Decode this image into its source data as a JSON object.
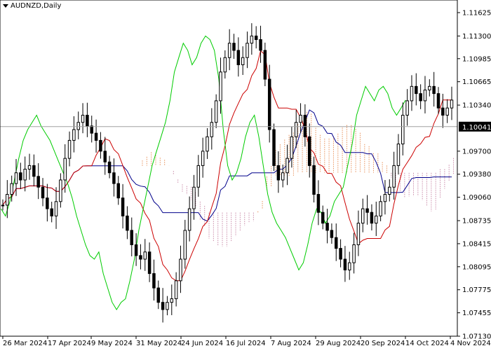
{
  "symbol": {
    "label": "AUDNZD,Daily"
  },
  "colors": {
    "candle": "#000000",
    "tenkan": "#cc0000",
    "kijun": "#00008b",
    "chikou": "#00cc00",
    "cloud_bull": "#e8915a",
    "cloud_bear": "#c98aa8",
    "current_line": "#a0a0a0",
    "price_badge_bg": "#000000",
    "price_badge_fg": "#ffffff"
  },
  "chart_data": {
    "type": "candlestick",
    "title": "AUDNZD,Daily",
    "indicator": "Ichimoku Kinko Hyo",
    "ylim": [
      1.0713,
      1.118
    ],
    "y_ticks": [
      "1.11625",
      "1.11300",
      "1.10985",
      "1.10665",
      "1.10340",
      "1.10041",
      "1.09700",
      "1.09380",
      "1.09060",
      "1.08735",
      "1.08415",
      "1.08095",
      "1.07775",
      "1.07455",
      "1.07130"
    ],
    "current_price": "1.10041",
    "x_labels": [
      "26 Mar 2024",
      "17 Apr 2024",
      "9 May 2024",
      "31 May 2024",
      "24 Jun 2024",
      "16 Jul 2024",
      "7 Aug 2024",
      "29 Aug 2024",
      "20 Sep 2024",
      "14 Oct 2024",
      "4 Nov 2024"
    ],
    "closes": [
      1.0895,
      1.091,
      1.0925,
      1.094,
      1.093,
      1.0945,
      1.095,
      1.0935,
      1.092,
      1.0905,
      1.089,
      1.088,
      1.09,
      1.093,
      1.096,
      1.0985,
      1.1,
      1.101,
      1.102,
      1.1005,
      1.0995,
      1.0985,
      1.097,
      1.0955,
      1.094,
      1.0925,
      1.0905,
      1.088,
      1.086,
      1.084,
      1.0825,
      1.082,
      1.083,
      1.08,
      1.078,
      1.076,
      1.075,
      1.076,
      1.0765,
      1.079,
      1.082,
      1.086,
      1.089,
      1.092,
      1.095,
      1.097,
      1.099,
      1.101,
      1.104,
      1.108,
      1.11,
      1.112,
      1.111,
      1.109,
      1.11,
      1.112,
      1.113,
      1.1125,
      1.111,
      1.107,
      1.1,
      1.095,
      1.093,
      1.094,
      1.096,
      1.099,
      1.101,
      1.102,
      1.099,
      1.095,
      1.091,
      1.0885,
      1.087,
      1.086,
      1.085,
      1.0835,
      1.082,
      1.0805,
      1.0815,
      1.084,
      1.087,
      1.089,
      1.0885,
      1.087,
      1.088,
      1.09,
      1.091,
      1.092,
      1.095,
      1.098,
      1.102,
      1.104,
      1.106,
      1.105,
      1.104,
      1.1055,
      1.106,
      1.105,
      1.103,
      1.102,
      1.103,
      1.1041
    ]
  }
}
